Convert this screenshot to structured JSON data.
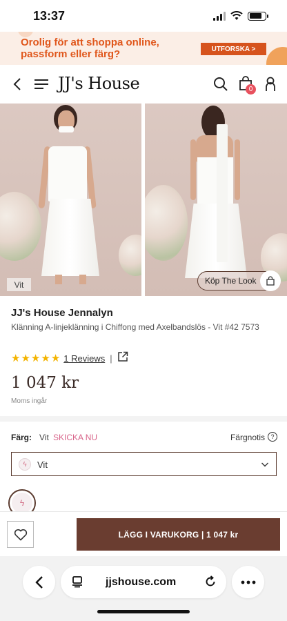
{
  "status_bar": {
    "time": "13:37",
    "battery_level": 0.8
  },
  "promo": {
    "text": "Orolig för att shoppa online, passform eller färg?",
    "button": "UTFORSKA >"
  },
  "header": {
    "logo": "JJ's House",
    "cart_count": "0"
  },
  "gallery": {
    "color_tag": "Vit",
    "shop_look": "Köp The Look"
  },
  "product": {
    "brand_title": "JJ's House Jennalyn",
    "description": "Klänning A-linjeklänning i Chiffong med Axelbandslös - Vit #42 7573",
    "rating": 5,
    "reviews": "1 Reviews",
    "price": "1 047 kr",
    "vat_note": "Moms ingår"
  },
  "color": {
    "label": "Färg:",
    "value": "Vit",
    "ship_now": "SKICKA NU",
    "note": "Färgnotis",
    "selected": "Vit"
  },
  "actions": {
    "add_to_cart": "LÄGG I VARUKORG | 1 047 kr"
  },
  "browser": {
    "url": "jjshouse.com"
  },
  "colors": {
    "accent": "#6a3d30",
    "promo": "#d6531d",
    "star": "#f4b400",
    "badge": "#e8515e",
    "ship_now": "#d8648a"
  }
}
